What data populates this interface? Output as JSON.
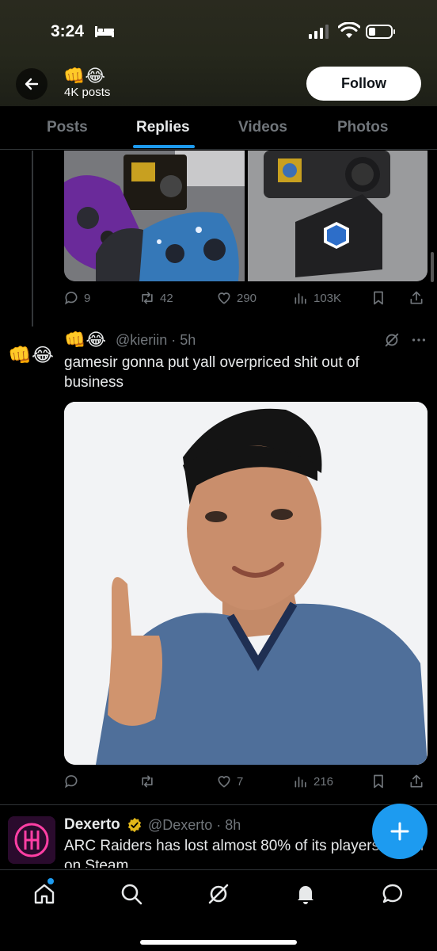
{
  "status_bar": {
    "time": "3:24"
  },
  "header": {
    "profile_name": "👊😂",
    "post_count": "4K posts",
    "follow_label": "Follow"
  },
  "tabs": [
    {
      "label": "Posts",
      "active": false
    },
    {
      "label": "Replies",
      "active": true
    },
    {
      "label": "Videos",
      "active": false
    },
    {
      "label": "Photos",
      "active": false
    }
  ],
  "previous_tweet": {
    "actions": {
      "replies": "9",
      "retweets": "42",
      "likes": "290",
      "views": "103K"
    }
  },
  "reply_tweet": {
    "avatar": "👊😂",
    "name": "👊😂",
    "handle_time": "@kieriin · 5h",
    "text": "gamesir gonna put yall overpriced shit out of business",
    "actions": {
      "replies": "",
      "retweets": "",
      "likes": "7",
      "views": "216"
    }
  },
  "next_tweet": {
    "name": "Dexerto",
    "handle_time": "@Dexerto · 8h",
    "text": "ARC Raiders has lost almost 80% of its players a year on Steam",
    "more": "⌄"
  },
  "colors": {
    "accent": "#1d9bf0",
    "muted": "#71767b",
    "verified_gold": "#e2b719"
  },
  "icons": [
    "back-arrow-icon",
    "bed-icon",
    "signal-icon",
    "wifi-icon",
    "battery-icon",
    "reply-icon",
    "retweet-icon",
    "like-icon",
    "views-icon",
    "bookmark-icon",
    "share-icon",
    "grok-icon",
    "more-icon",
    "verified-icon",
    "compose-plus-icon",
    "home-icon",
    "search-icon",
    "notifications-icon",
    "messages-icon"
  ]
}
